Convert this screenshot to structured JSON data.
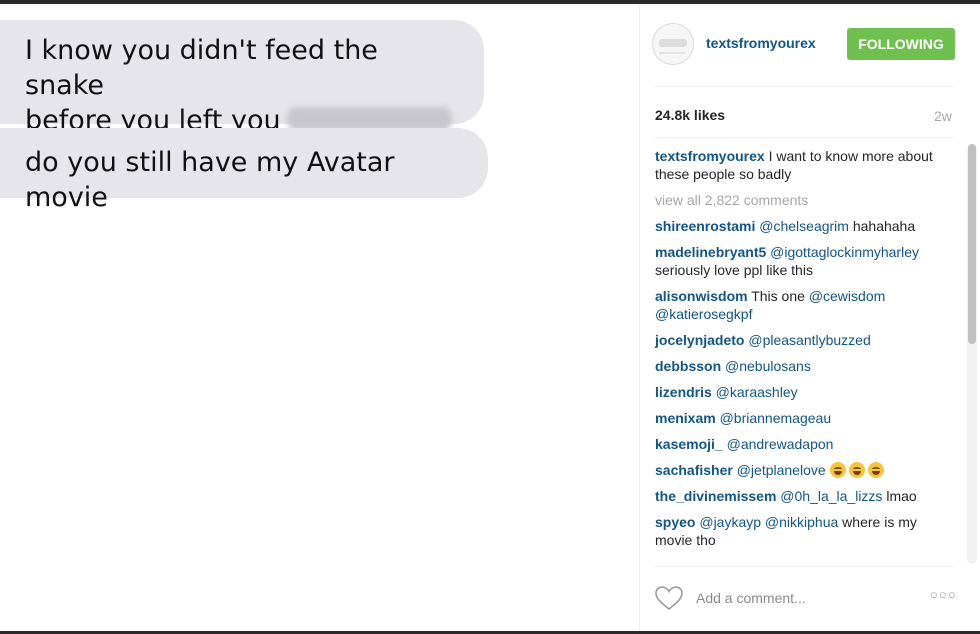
{
  "photo": {
    "messages": [
      {
        "line1": "I know you didn't feed the snake",
        "line2": "before you left you"
      },
      {
        "line1": "do you still have my Avatar movie"
      }
    ]
  },
  "header": {
    "username": "textsfromyourex",
    "follow_label": "FOLLOWING",
    "follow_color": "#70c050"
  },
  "stats": {
    "likes": "24.8k likes",
    "time": "2w"
  },
  "caption": {
    "user": "textsfromyourex",
    "text": " I want to know more about these people so badly"
  },
  "view_all": "view all 2,822 comments",
  "comments": [
    {
      "user": "shireenrostami",
      "mention": " @chelseagrim",
      "text": " hahahaha"
    },
    {
      "user": "madelinebryant5",
      "mention": " @igottaglockinmyharley",
      "text": " seriously love ppl like this"
    },
    {
      "user": "alisonwisdom",
      "mention": "",
      "text": " This one ",
      "mention2": "@cewisdom @katierosegkpf"
    },
    {
      "user": "jocelynjadeto",
      "mention": " @pleasantlybuzzed",
      "text": ""
    },
    {
      "user": "debbsson",
      "mention": " @nebulosans",
      "text": ""
    },
    {
      "user": "lizendris",
      "mention": " @karaashley",
      "text": ""
    },
    {
      "user": "menixam",
      "mention": " @briannemageau",
      "text": ""
    },
    {
      "user": "kasemoji_",
      "mention": " @andrewadapon",
      "text": ""
    },
    {
      "user": "sachafisher",
      "mention": " @jetplanelove",
      "text": " "
    },
    {
      "user": "the_divinemissem",
      "mention": " @0h_la_la_lizzs",
      "text": " lmao"
    },
    {
      "user": "spyeo",
      "mention": " @jaykayp @nikkiphua",
      "text": " where is my movie tho"
    }
  ],
  "comment_input": {
    "placeholder": "Add a comment..."
  },
  "icons": {
    "heart": "heart-icon",
    "more": "more-options-icon",
    "emoji": "laughing-emoji-icon"
  },
  "colors": {
    "link": "#125688",
    "bubble": "#e6e5eb",
    "muted": "#a5a7aa"
  }
}
